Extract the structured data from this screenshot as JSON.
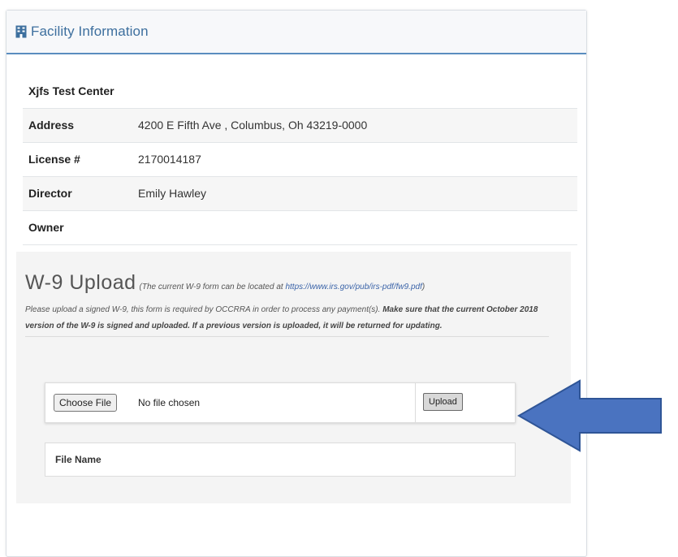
{
  "panel": {
    "title": "Facility Information",
    "icon": "building-icon",
    "accent_color": "#3d6f9e"
  },
  "facility": {
    "name": "Xjfs Test Center",
    "rows": [
      {
        "label": "Address",
        "value": "4200 E Fifth Ave , Columbus, Oh 43219-0000"
      },
      {
        "label": "License #",
        "value": "2170014187"
      },
      {
        "label": "Director",
        "value": "Emily Hawley"
      },
      {
        "label": "Owner",
        "value": ""
      }
    ]
  },
  "w9": {
    "title": "W-9 Upload",
    "note_prefix": "(The current W-9 form can be located at ",
    "note_link": "https://www.irs.gov/pub/irs-pdf/fw9.pdf",
    "note_suffix": ")",
    "instructions_plain": "Please upload a signed W-9, this form is required by OCCRRA in order to process any payment(s). ",
    "instructions_bold": "Make sure that the current October 2018 version of the W-9 is signed and uploaded. If a previous version is uploaded, it will be returned for updating."
  },
  "file_input": {
    "choose_label": "Choose File",
    "status": "No file chosen",
    "upload_label": "Upload"
  },
  "file_list": {
    "header": "File Name"
  },
  "arrow": {
    "icon": "arrow-left-icon",
    "color": "#4a73c0"
  }
}
